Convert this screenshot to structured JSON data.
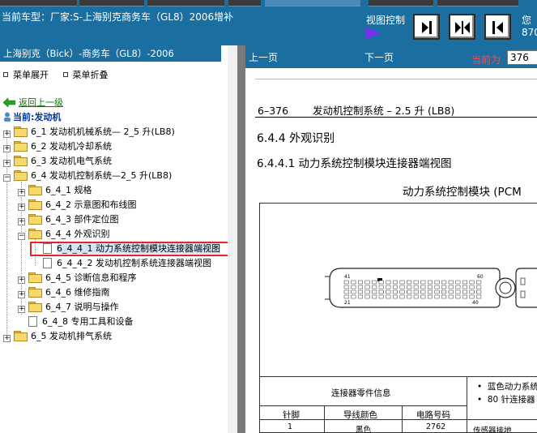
{
  "header": {
    "car_model": "当前车型：厂家:S-上海别克商务车（GL8）2006增补",
    "view_control": "视图控制",
    "cut_text_1": "您",
    "cut_text_2": "870",
    "buttons": [
      {
        "name": "view-button-single-right",
        "icon": "arrow-right-bar-icon"
      },
      {
        "name": "view-button-dual",
        "icon": "arrows-both-icon"
      },
      {
        "name": "view-button-single-left",
        "icon": "arrow-left-bar-icon"
      }
    ],
    "accent_color": "#1a6fa0"
  },
  "left": {
    "title": "上海别克（Bick）-商务车（GL8）-2006",
    "expand_menu": "菜单展开",
    "collapse_menu": "菜单折叠",
    "back": "返回上一级",
    "current": "当前:发动机",
    "tree": [
      {
        "label": "6_1 发动机机械系统— 2_5 升(LB8)",
        "type": "folder",
        "sign": "+"
      },
      {
        "label": "6_2 发动机冷却系统",
        "type": "folder",
        "sign": "+"
      },
      {
        "label": "6_3 发动机电气系统",
        "type": "folder",
        "sign": "+"
      },
      {
        "label": "6_4 发动机控制系统—2_5 升(LB8)",
        "type": "folder",
        "sign": "−"
      },
      {
        "label": "6_4_1 规格",
        "type": "folder",
        "sign": "+"
      },
      {
        "label": "6_4_2 示意图和布线图",
        "type": "folder",
        "sign": "+"
      },
      {
        "label": "6_4_3 部件定位图",
        "type": "folder",
        "sign": "+"
      },
      {
        "label": "6_4_4 外观识别",
        "type": "folder",
        "sign": "−"
      },
      {
        "label": "6_4_4_1 动力系统控制模块连接器端视图",
        "type": "doc",
        "sign": ""
      },
      {
        "label": "6_4_4_2 发动机控制系统连接器端视图",
        "type": "doc",
        "sign": ""
      },
      {
        "label": "6_4_5 诊断信息和程序",
        "type": "folder",
        "sign": "+"
      },
      {
        "label": "6_4_6 维修指南",
        "type": "folder",
        "sign": "+"
      },
      {
        "label": "6_4_7 说明与操作",
        "type": "folder",
        "sign": "+"
      },
      {
        "label": "6_4_8 专用工具和设备",
        "type": "doc",
        "sign": ""
      },
      {
        "label": "6_5 发动机排气系统",
        "type": "folder",
        "sign": "+"
      }
    ]
  },
  "right": {
    "prev": "上一页",
    "next": "下一页",
    "current_label": "当前为",
    "current_page": "376",
    "doc_num": "6–376",
    "doc_title": "发动机控制系统 – 2.5 升 (LB8)",
    "section": "6.4.4 外观识别",
    "subsection": "6.4.4.1 动力系统控制模块连接器端视图",
    "diagram_title": "动力系统控制模块 (PCM",
    "pin_labels": [
      "41",
      "60",
      "21",
      "40"
    ],
    "table": {
      "group_header": "连接器零件信息",
      "bullets": [
        "蓝色动力系统",
        "80 针连接器"
      ],
      "headers": [
        "针脚",
        "导线颜色",
        "电路号码"
      ],
      "row": [
        "1",
        "黑色",
        "2762",
        "传感器接地"
      ]
    }
  }
}
